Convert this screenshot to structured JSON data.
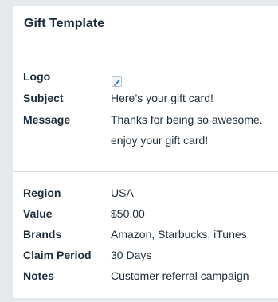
{
  "template": {
    "title": "Gift Template",
    "logo_label": "Logo",
    "logo_icon": "brand-logo-icon",
    "subject_label": "Subject",
    "subject_value": "Here’s your gift card!",
    "message_label": "Message",
    "message_line1": "Thanks for being so awesome.",
    "message_line2": "enjoy your gift card!"
  },
  "details": {
    "region_label": "Region",
    "region_value": "USA",
    "value_label": "Value",
    "value_value": "$50.00",
    "brands_label": "Brands",
    "brands_value": "Amazon, Starbucks, iTunes",
    "claim_label": "Claim Period",
    "claim_value": "30 Days",
    "notes_label": "Notes",
    "notes_value": "Customer referral campaign"
  },
  "colors": {
    "text": "#1b2b3c",
    "logo_accent": "#2a7fd4"
  }
}
